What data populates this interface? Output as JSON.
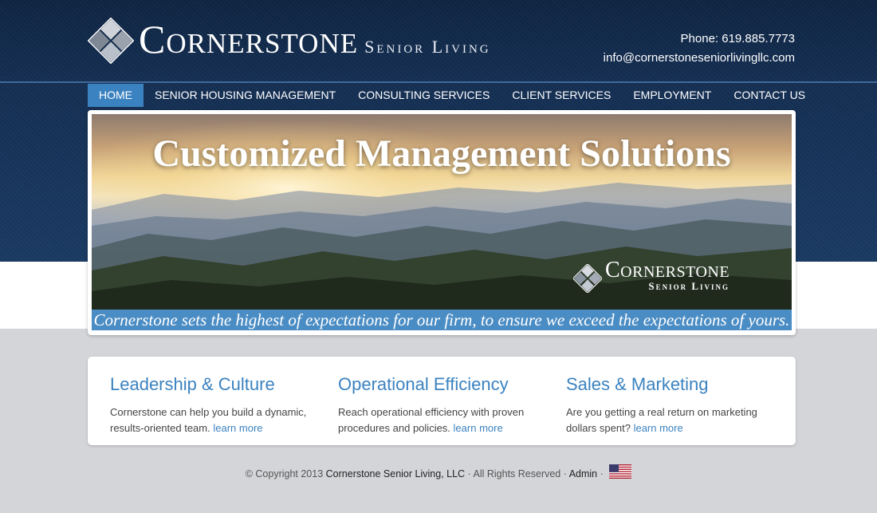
{
  "brand": {
    "name": "Cornerstone",
    "tagline": "Senior Living"
  },
  "contact": {
    "phone": "Phone: 619.885.7773",
    "email": "info@cornerstoneseniorlivingllc.com"
  },
  "nav": [
    {
      "label": "HOME",
      "active": true
    },
    {
      "label": "SENIOR HOUSING MANAGEMENT",
      "active": false
    },
    {
      "label": "CONSULTING SERVICES",
      "active": false
    },
    {
      "label": "CLIENT SERVICES",
      "active": false
    },
    {
      "label": "EMPLOYMENT",
      "active": false
    },
    {
      "label": "CONTACT US",
      "active": false
    }
  ],
  "banner": {
    "heading": "Customized Management Solutions",
    "logo_main": "Cornerstone",
    "logo_sub": "Senior Living",
    "caption": "Cornerstone sets the highest of expectations for our firm, to ensure we exceed the expectations of yours."
  },
  "features": [
    {
      "title": "Leadership & Culture",
      "text": "Cornerstone can help you build a dynamic, results-oriented team.",
      "link": "learn more"
    },
    {
      "title": "Operational Efficiency",
      "text": "Reach operational efficiency with proven procedures and policies.",
      "link": "learn more"
    },
    {
      "title": "Sales & Marketing",
      "text": "Are you getting a real return on marketing dollars spent?",
      "link": "learn more"
    }
  ],
  "footer": {
    "copyright": "© Copyright 2013",
    "company": "Cornerstone Senior Living, LLC",
    "rights": "· All Rights Reserved ·",
    "admin": "Admin",
    "sep": "·",
    "flag_icon": "us-flag-icon"
  },
  "colors": {
    "header": "#142e52",
    "accent": "#3b82c0",
    "background": "#d4d5d8"
  }
}
